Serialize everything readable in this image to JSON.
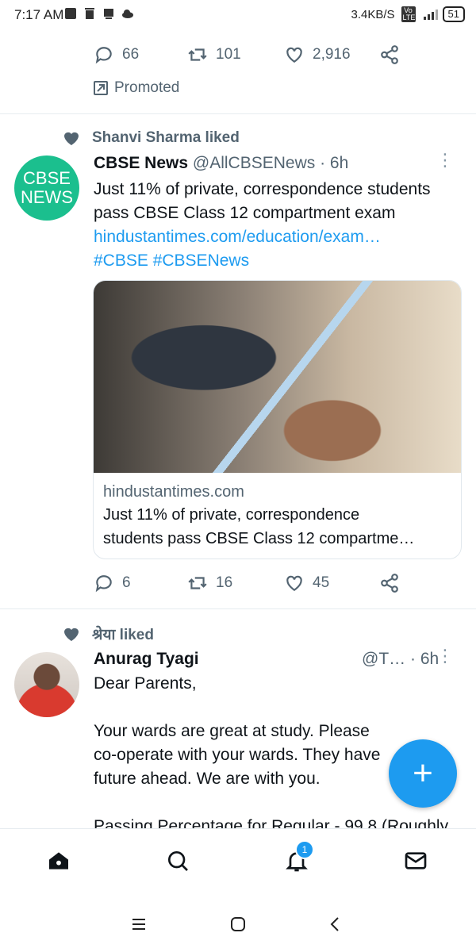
{
  "status_bar": {
    "time": "7:17 AM",
    "net_speed": "3.4KB/S",
    "volte": "Vo LTE",
    "battery": "51"
  },
  "top_tweet_actions": {
    "replies": "66",
    "retweets": "101",
    "likes": "2,916"
  },
  "promoted": {
    "label": "Promoted"
  },
  "tweet1": {
    "liked_by": "Shanvi Sharma liked",
    "avatar_text_1": "CBSE",
    "avatar_text_2": "NEWS",
    "name": "CBSE News",
    "handle": "@AllCBSENews",
    "time": "· 6h",
    "text_line_1": "Just 11% of private, correspondence students",
    "text_line_2": "pass CBSE Class 12 compartment exam",
    "link": "hindustantimes.com/education/exam…",
    "hashtags": "#CBSE #CBSENews",
    "card": {
      "domain": "hindustantimes.com",
      "title_line_1": "Just 11% of private, correspondence",
      "title_line_2": "students pass CBSE Class 12 compartme…"
    },
    "actions": {
      "replies": "6",
      "retweets": "16",
      "likes": "45"
    }
  },
  "tweet2": {
    "liked_by": "श्रेया liked",
    "name": "Anurag Tyagi",
    "handle": "@T…",
    "time": "· 6h",
    "line_1": "Dear Parents,",
    "line_2": "Your wards are great at study. Please",
    "line_3": "co-operate with your wards. They have",
    "line_4": "future ahead. We are with you.",
    "line_5": "Passing Percentage for Regular - 99.8 (Roughly"
  },
  "fab": {
    "label": "+"
  },
  "bottom_nav": {
    "notifications_badge": "1"
  },
  "colors": {
    "accent": "#1d9bf0",
    "muted": "#536471",
    "cbse_green": "#1bbf8e"
  }
}
